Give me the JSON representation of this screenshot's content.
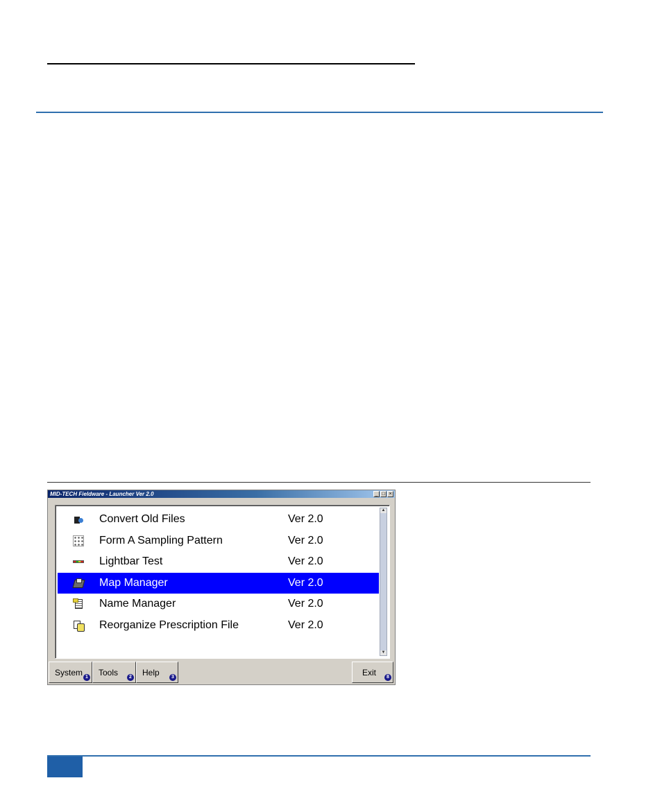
{
  "window": {
    "title": "MID-TECH Fieldware - Launcher Ver 2.0",
    "controls": [
      "_",
      "□",
      "×"
    ]
  },
  "list": {
    "items": [
      {
        "name": "Convert Old Files",
        "version": "Ver 2.0",
        "icon": "convert-files-icon",
        "selected": false
      },
      {
        "name": "Form A Sampling Pattern",
        "version": "Ver 2.0",
        "icon": "sampling-pattern-icon",
        "selected": false
      },
      {
        "name": "Lightbar Test",
        "version": "Ver 2.0",
        "icon": "lightbar-icon",
        "selected": false
      },
      {
        "name": "Map Manager",
        "version": "Ver 2.0",
        "icon": "map-manager-icon",
        "selected": true
      },
      {
        "name": "Name Manager",
        "version": "Ver 2.0",
        "icon": "name-manager-icon",
        "selected": false
      },
      {
        "name": "Reorganize Prescription File",
        "version": "Ver 2.0",
        "icon": "reorganize-file-icon",
        "selected": false
      }
    ]
  },
  "tabs": [
    {
      "label": "System",
      "number": "1"
    },
    {
      "label": "Tools",
      "number": "2"
    },
    {
      "label": "Help",
      "number": "3"
    }
  ],
  "exit": {
    "label": "Exit",
    "number": "8"
  },
  "colors": {
    "selection": "#0000ff",
    "rule_blue": "#2f6fae",
    "footer_block": "#1f5fa7"
  }
}
